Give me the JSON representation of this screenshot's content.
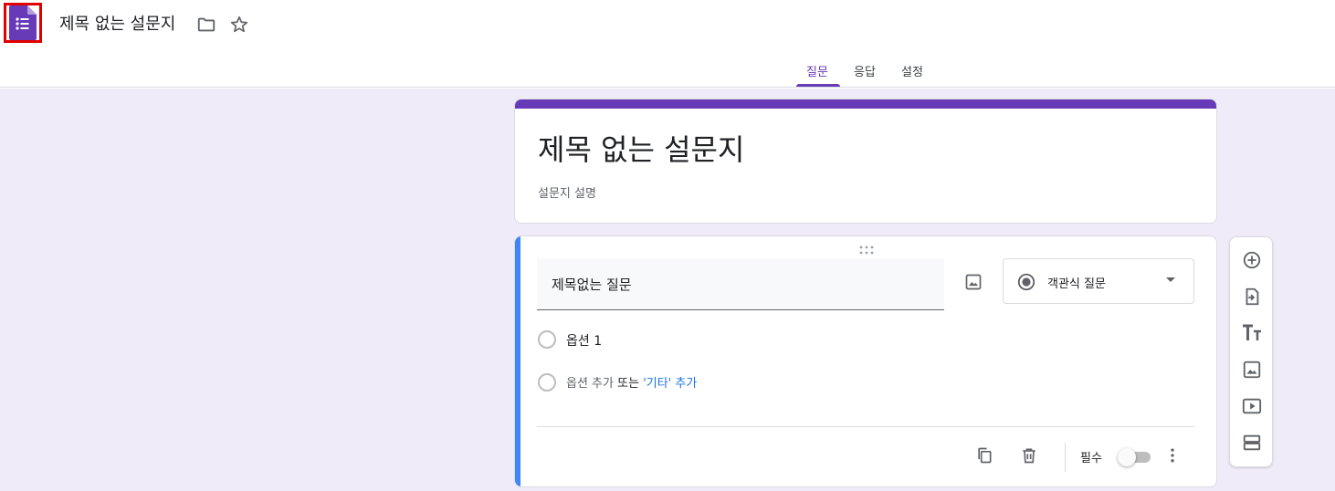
{
  "header": {
    "doc_title": "제목 없는 설문지",
    "tabs": [
      {
        "label": "질문",
        "active": true
      },
      {
        "label": "응답",
        "active": false
      },
      {
        "label": "설정",
        "active": false
      }
    ]
  },
  "form": {
    "title": "제목 없는 설문지",
    "description": "설문지 설명"
  },
  "question": {
    "title": "제목없는 질문",
    "type_label": "객관식 질문",
    "option_1": "옵션 1",
    "add_option": "옵션 추가",
    "or_text": "또는",
    "add_other": "'기타' 추가",
    "required_label": "필수",
    "required_on": false
  },
  "colors": {
    "accent": "#673ab7",
    "canvas_bg": "#f0ebf8",
    "active_question": "#4285f4",
    "link": "#1a73e8"
  },
  "icons": {
    "logo": "forms-logo-icon",
    "folder": "folder-icon",
    "star": "star-icon",
    "image": "image-icon",
    "copy": "copy-icon",
    "delete": "trash-icon",
    "more": "more-vert-icon",
    "side_toolbar": [
      "add-circle-icon",
      "import-icon",
      "title-text-icon",
      "image-icon",
      "video-icon",
      "section-icon"
    ]
  }
}
